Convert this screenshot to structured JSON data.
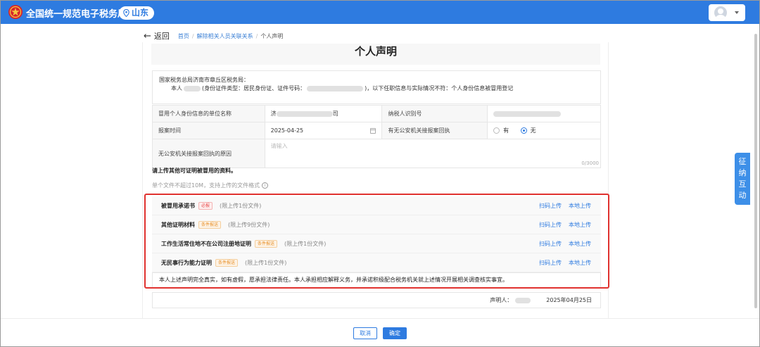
{
  "header": {
    "app_title": "全国统一规范电子税务局",
    "region": "山东",
    "brand_color": "#2e7be0"
  },
  "breadcrumb": {
    "back_label": "返回",
    "items": [
      "首页",
      "解除相关人员关联关系",
      "个人声明"
    ]
  },
  "document": {
    "title": "个人声明",
    "recipient": "国家税务总局济南市章丘区税务局：",
    "line2_prefix": "本人",
    "line2_mid": "(身份证件类型：居民身份证、证件号码：",
    "line2_suffix": ")，以下任职信息与实际情况不符：个人身份信息被冒用登记"
  },
  "form": {
    "unit_label": "冒用个人身份信息的单位名称",
    "unit_value_prefix": "济",
    "unit_value_suffix": "司",
    "taxpayer_id_label": "纳税人识别号",
    "report_time_label": "报案时间",
    "report_time_value": "2025-04-25",
    "receipt_label": "有无公安机关接报案回执",
    "receipt_options": [
      "有",
      "无"
    ],
    "receipt_selected": "无",
    "reason_label": "无公安机关接报案回执的原因",
    "reason_placeholder": "请输入",
    "reason_counter": "0/3000"
  },
  "upload": {
    "heading": "请上传其他可证明被冒用的资料。",
    "tip": "单个文件不超过10M，支持上传的文件格式",
    "scan_label": "扫码上传",
    "local_label": "本地上传",
    "items": [
      {
        "name": "被冒用承诺书",
        "tag": "必报",
        "tag_type": "req",
        "limit": "(限上传1份文件)"
      },
      {
        "name": "其他证明材料",
        "tag": "条件报送",
        "tag_type": "cond",
        "limit": "(限上传9份文件)"
      },
      {
        "name": "工作生活常住地不在公司注册地证明",
        "tag": "条件报送",
        "tag_type": "cond",
        "limit": "(限上传1份文件)"
      },
      {
        "name": "无民事行为能力证明",
        "tag": "条件报送",
        "tag_type": "cond",
        "limit": "(限上传1份文件)"
      }
    ],
    "commitment": "本人上述声明完全真实，如有虚假，愿承担法律责任。本人承担相应解释义务，并承诺积极配合税务机关就上述情况开展相关调查核实事宜。"
  },
  "signature": {
    "label": "声明人：",
    "date": "2025年04月25日"
  },
  "footer": {
    "cancel_label": "取消",
    "confirm_label": "确定"
  },
  "side_tab": {
    "chars": [
      "征",
      "纳",
      "互",
      "动"
    ]
  }
}
